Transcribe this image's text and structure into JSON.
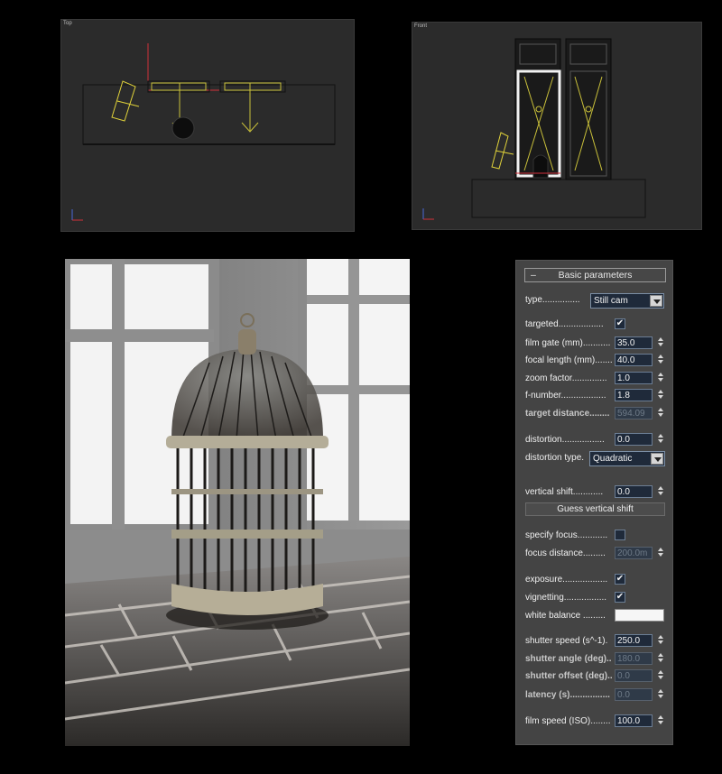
{
  "viewports": {
    "top_label": "Top",
    "front_label": "Front"
  },
  "panel": {
    "rollout_minus": "–",
    "rollout_title": "Basic parameters",
    "type_label": "type...............",
    "type_value": "Still cam",
    "targeted_label": "targeted..................",
    "targeted_checked": "✔",
    "film_gate_label": "film gate (mm)...........",
    "film_gate_value": "35.0",
    "focal_length_label": "focal length (mm).......",
    "focal_length_value": "40.0",
    "zoom_factor_label": "zoom factor..............",
    "zoom_factor_value": "1.0",
    "f_number_label": "f-number..................",
    "f_number_value": "1.8",
    "target_distance_label": "target distance........",
    "target_distance_value": "594.09",
    "distortion_label": "distortion.................",
    "distortion_value": "0.0",
    "distortion_type_label": "distortion type.",
    "distortion_type_value": "Quadratic",
    "vertical_shift_label": "vertical shift............",
    "vertical_shift_value": "0.0",
    "guess_button": "Guess vertical shift",
    "specify_focus_label": "specify focus............",
    "focus_distance_label": "focus distance.........",
    "focus_distance_value": "200.0m",
    "exposure_label": "exposure..................",
    "exposure_checked": "✔",
    "vignetting_label": "vignetting.................",
    "vignetting_checked": "✔",
    "white_balance_label": "white balance .........",
    "white_balance_color": "#f6f6f6",
    "shutter_speed_label": "shutter speed (s^-1).",
    "shutter_speed_value": "250.0",
    "shutter_angle_label": "shutter angle (deg)..",
    "shutter_angle_value": "180.0",
    "shutter_offset_label": "shutter offset (deg)..",
    "shutter_offset_value": "0.0",
    "latency_label": "latency (s)................",
    "latency_value": "0.0",
    "film_speed_label": "film speed (ISO)........",
    "film_speed_value": "100.0"
  }
}
